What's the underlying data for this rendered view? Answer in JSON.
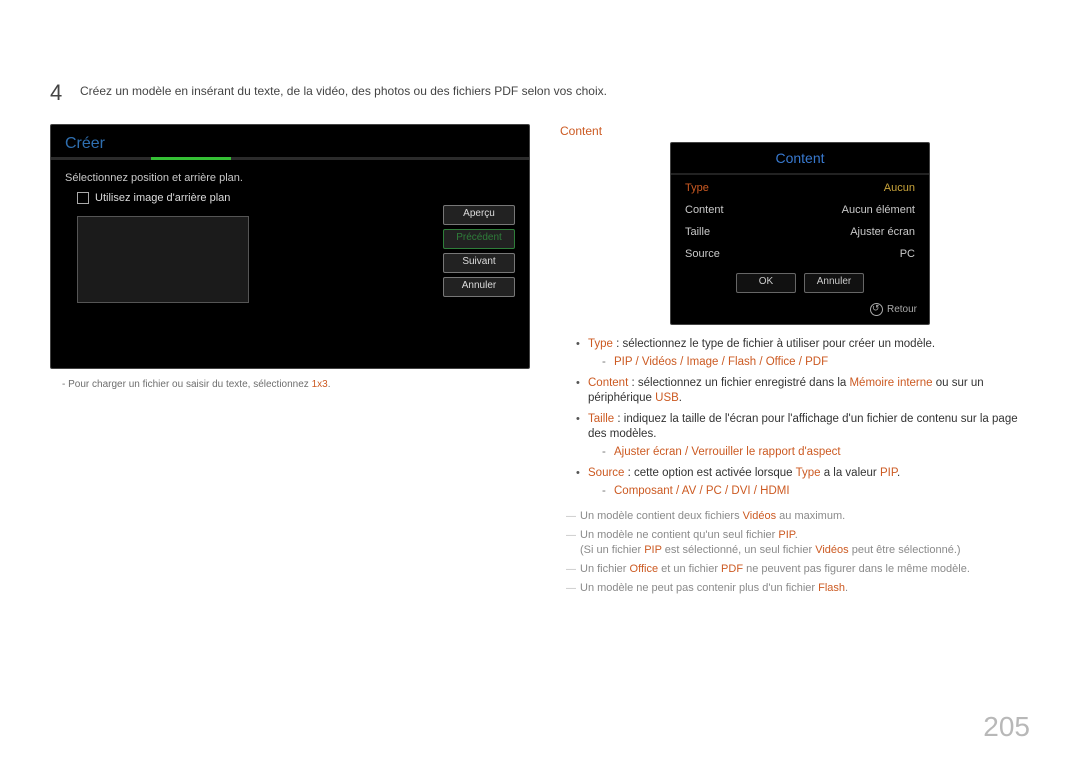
{
  "step": {
    "number": "4",
    "text": "Créez un modèle en insérant du texte, de la vidéo, des photos ou des fichiers PDF selon vos choix."
  },
  "content_label": "Content",
  "leftPanel": {
    "title": "Créer",
    "instruction": "Sélectionnez position et arrière plan.",
    "checkbox_label": "Utilisez image d'arrière plan",
    "buttons": {
      "preview": "Aperçu",
      "previous": "Précédent",
      "next": "Suivant",
      "cancel": "Annuler"
    }
  },
  "leftCaption": {
    "pre": "- Pour charger un fichier ou saisir du texte, sélectionnez ",
    "hl": "1x3"
  },
  "contentPanel": {
    "title": "Content",
    "rows": [
      {
        "k": "Type",
        "v": "Aucun",
        "hl": true
      },
      {
        "k": "Content",
        "v": "Aucun élément",
        "hl": false
      },
      {
        "k": "Taille",
        "v": "Ajuster écran",
        "hl": false
      },
      {
        "k": "Source",
        "v": "PC",
        "hl": false
      }
    ],
    "ok": "OK",
    "cancel": "Annuler",
    "retour": "Retour"
  },
  "bullets": {
    "type": {
      "hl": "Type",
      "text": " : sélectionnez le type de fichier à utiliser pour créer un modèle.",
      "sub": "PIP / Vidéos / Image / Flash / Office / PDF"
    },
    "content": {
      "hl": "Content",
      "text": " : sélectionnez un fichier enregistré dans la ",
      "hl2": "Mémoire interne",
      "text2": " ou sur un périphérique ",
      "hl3": "USB",
      "text3": "."
    },
    "taille": {
      "hl": "Taille",
      "text": " : indiquez la taille de l'écran pour l'affichage d'un fichier de contenu sur la page des modèles.",
      "sub": "Ajuster écran / Verrouiller le rapport d'aspect"
    },
    "source": {
      "hl": "Source",
      "text": " : cette option est activée lorsque ",
      "hl2": "Type",
      "text2": " a la valeur ",
      "hl3": "PIP",
      "text3": ".",
      "sub": "Composant / AV / PC / DVI / HDMI"
    }
  },
  "notes": {
    "n1a": "Un modèle contient deux fichiers ",
    "n1b": "Vidéos",
    "n1c": " au maximum.",
    "n2a": "Un modèle ne contient qu'un seul fichier ",
    "n2b": "PIP",
    "n2c": ".",
    "n2p_a": "(Si un fichier ",
    "n2p_b": "PIP",
    "n2p_c": " est sélectionné, un seul fichier ",
    "n2p_d": "Vidéos",
    "n2p_e": " peut être sélectionné.)",
    "n3a": "Un fichier ",
    "n3b": "Office",
    "n3c": " et un fichier ",
    "n3d": "PDF",
    "n3e": " ne peuvent pas figurer dans le même modèle.",
    "n4a": "Un modèle ne peut pas contenir plus d'un fichier ",
    "n4b": "Flash",
    "n4c": "."
  },
  "page_number": "205"
}
